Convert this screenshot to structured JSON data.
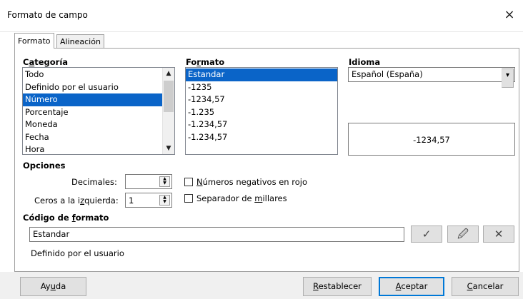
{
  "window": {
    "title": "Formato de campo",
    "close_glyph": "×"
  },
  "tabs": [
    {
      "label": "Formato",
      "active": true
    },
    {
      "label": "Alineación",
      "active": false
    }
  ],
  "categoria": {
    "header_pre": "C",
    "header_ul": "a",
    "header_post": "tegoría",
    "items": [
      "Todo",
      "Definido por el usuario",
      "Número",
      "Porcentaje",
      "Moneda",
      "Fecha",
      "Hora"
    ],
    "selected": "Número"
  },
  "formato": {
    "header_pre": "Fo",
    "header_ul": "r",
    "header_post": "mato",
    "items": [
      "Estandar",
      "-1235",
      "-1234,57",
      "-1.235",
      "-1.234,57",
      "-1.234,57"
    ],
    "selected": "Estandar"
  },
  "idioma": {
    "header": "Idioma",
    "value": "Español (España)"
  },
  "preview": {
    "value": "-1234,57"
  },
  "opciones": {
    "header": "Opciones",
    "decimales_label": "Decimales:",
    "decimales_value": "",
    "ceros_pre": "Ceros a la i",
    "ceros_ul": "z",
    "ceros_post": "quierda:",
    "ceros_value": "1",
    "negativos_ul": "N",
    "negativos_post": "úmeros negativos en rojo",
    "negativos_checked": false,
    "separador_pre": "Separador de ",
    "separador_ul": "m",
    "separador_post": "illares",
    "separador_checked": false
  },
  "codigo": {
    "header_pre": "Código de ",
    "header_ul": "f",
    "header_post": "ormato",
    "value": "Estandar",
    "description": "Definido por el usuario"
  },
  "buttons": {
    "ayuda_pre": "Ay",
    "ayuda_ul": "u",
    "ayuda_post": "da",
    "restablecer_ul": "R",
    "restablecer_post": "establecer",
    "aceptar_ul": "A",
    "aceptar_post": "ceptar",
    "cancelar_ul": "C",
    "cancelar_post": "ancelar"
  },
  "colors": {
    "selection": "#0a64c8",
    "default_button_border": "#0078d7"
  },
  "icons": [
    "close-icon",
    "chevron-down-icon",
    "chevron-up-icon",
    "checkmark-icon",
    "edit-format-icon",
    "cross-icon"
  ]
}
